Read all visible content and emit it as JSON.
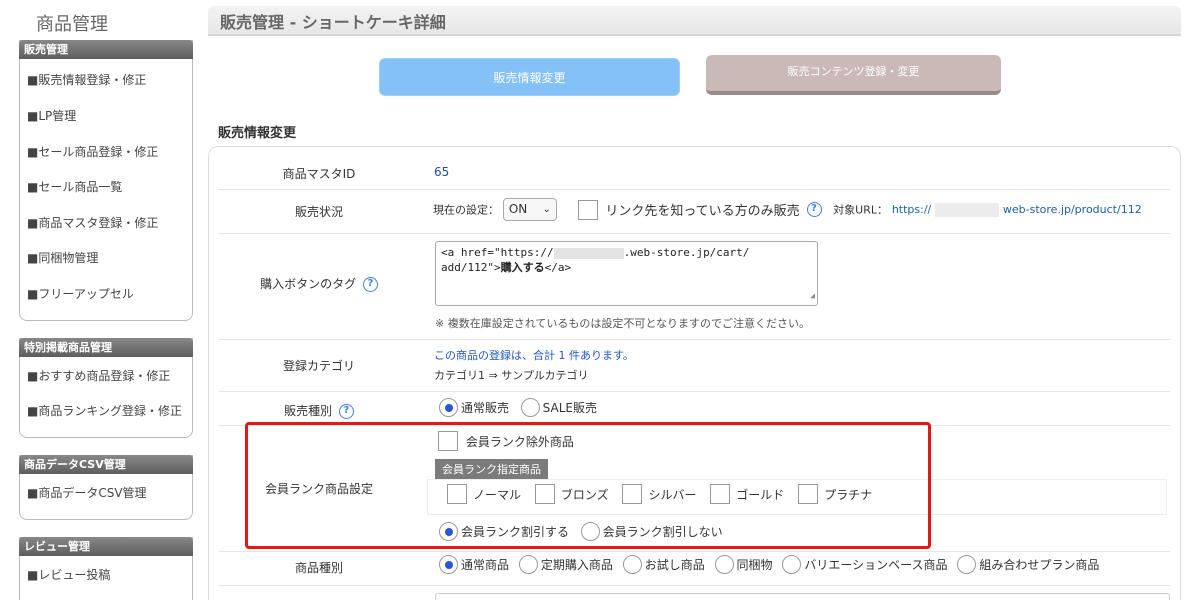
{
  "sidebar": {
    "title": "商品管理",
    "sections": [
      {
        "heading": "販売管理",
        "items": [
          "■販売情報登録・修正",
          "■LP管理",
          "■セール商品登録・修正",
          "■セール商品一覧",
          "■商品マスタ登録・修正",
          "■同梱物管理",
          "■フリーアップセル"
        ]
      },
      {
        "heading": "特別掲載商品管理",
        "items": [
          "■おすすめ商品登録・修正",
          "■商品ランキング登録・修正"
        ]
      },
      {
        "heading": "商品データCSV管理",
        "items": [
          "■商品データCSV管理"
        ]
      },
      {
        "heading": "レビュー管理",
        "items": [
          "■レビュー投稿"
        ]
      }
    ]
  },
  "main": {
    "page_title": "販売管理 - ショートケーキ詳細",
    "tabs": {
      "sales": "販売情報変更",
      "content": "販売コンテンツ登録・変更"
    },
    "section_title": "販売情報変更",
    "form": {
      "master_id": {
        "label": "商品マスタID",
        "value": "65"
      },
      "status": {
        "label": "販売状況",
        "current_prefix": "現在の設定：",
        "select_value": "ON",
        "limited_checkbox": "リンク先を知っている方のみ販売",
        "url_prefix": "対象URL：",
        "url_start": "https://",
        "url_end": "web-store.jp/product/112"
      },
      "tag": {
        "label": "購入ボタンのタグ",
        "code_part1": "<a href=\"https://",
        "code_part2": ".web-store.jp/cart/\nadd/112\">",
        "code_bold": "購入する",
        "code_part3": "</a>",
        "note": "※ 複数在庫設定されているものは設定不可となりますのでご注意ください。"
      },
      "category": {
        "label": "登録カテゴリ",
        "count_note": "この商品の登録は、合計 1 件あります。",
        "path": "カテゴリ1 ⇒ サンプルカテゴリ"
      },
      "sale_type": {
        "label": "販売種別",
        "options": [
          "通常販売",
          "SALE販売"
        ],
        "selected": 0
      },
      "member_rank": {
        "label": "会員ランク商品設定",
        "exclude_checkbox": "会員ランク除外商品",
        "sub_heading": "会員ランク指定商品",
        "ranks": [
          "ノーマル",
          "ブロンズ",
          "シルバー",
          "ゴールド",
          "プラチナ"
        ],
        "discount_options": [
          "会員ランク割引する",
          "会員ランク割引しない"
        ],
        "selected": 0
      },
      "product_type": {
        "label": "商品種別",
        "options": [
          "通常商品",
          "定期購入商品",
          "お試し商品",
          "同梱物",
          "バリエーションベース商品",
          "組み合わせプラン商品"
        ],
        "selected": 0
      }
    }
  }
}
